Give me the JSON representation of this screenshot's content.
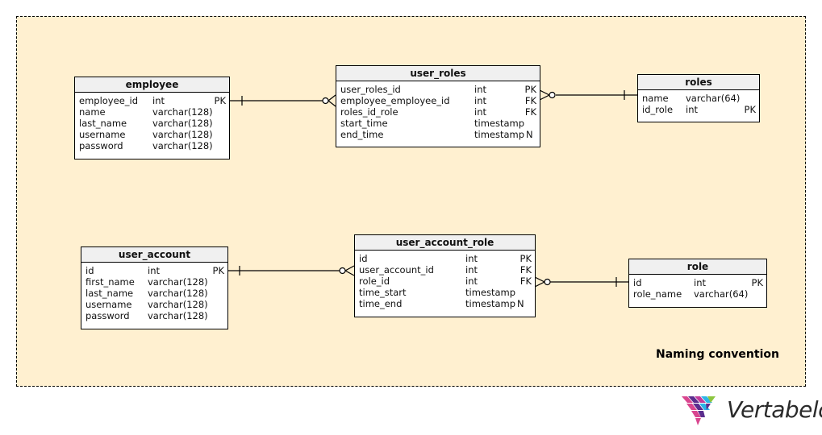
{
  "diagram": {
    "title": "Naming convention",
    "background_color": "#fff0d0",
    "tables": {
      "employee": {
        "name": "employee",
        "columns": [
          {
            "name": "employee_id",
            "type": "int",
            "key": "PK"
          },
          {
            "name": "name",
            "type": "varchar(128)",
            "key": ""
          },
          {
            "name": "last_name",
            "type": "varchar(128)",
            "key": ""
          },
          {
            "name": "username",
            "type": "varchar(128)",
            "key": ""
          },
          {
            "name": "password",
            "type": "varchar(128)",
            "key": ""
          }
        ]
      },
      "user_roles": {
        "name": "user_roles",
        "columns": [
          {
            "name": "user_roles_id",
            "type": "int",
            "key": "PK"
          },
          {
            "name": "employee_employee_id",
            "type": "int",
            "key": "FK"
          },
          {
            "name": "roles_id_role",
            "type": "int",
            "key": "FK"
          },
          {
            "name": "start_time",
            "type": "timestamp",
            "key": ""
          },
          {
            "name": "end_time",
            "type": "timestamp",
            "key": "N"
          }
        ]
      },
      "roles": {
        "name": "roles",
        "columns": [
          {
            "name": "name",
            "type": "varchar(64)",
            "key": ""
          },
          {
            "name": "id_role",
            "type": "int",
            "key": "PK"
          }
        ]
      },
      "user_account": {
        "name": "user_account",
        "columns": [
          {
            "name": "id",
            "type": "int",
            "key": "PK"
          },
          {
            "name": "first_name",
            "type": "varchar(128)",
            "key": ""
          },
          {
            "name": "last_name",
            "type": "varchar(128)",
            "key": ""
          },
          {
            "name": "username",
            "type": "varchar(128)",
            "key": ""
          },
          {
            "name": "password",
            "type": "varchar(128)",
            "key": ""
          }
        ]
      },
      "user_account_role": {
        "name": "user_account_role",
        "columns": [
          {
            "name": "id",
            "type": "int",
            "key": "PK"
          },
          {
            "name": "user_account_id",
            "type": "int",
            "key": "FK"
          },
          {
            "name": "role_id",
            "type": "int",
            "key": "FK"
          },
          {
            "name": "time_start",
            "type": "timestamp",
            "key": ""
          },
          {
            "name": "time_end",
            "type": "timestamp",
            "key": "N"
          }
        ]
      },
      "role": {
        "name": "role",
        "columns": [
          {
            "name": "id",
            "type": "int",
            "key": "PK"
          },
          {
            "name": "role_name",
            "type": "varchar(64)",
            "key": ""
          }
        ]
      }
    },
    "relationships": [
      {
        "from": "employee",
        "to": "user_roles",
        "from_cardinality": "one",
        "to_cardinality": "zero-or-many"
      },
      {
        "from": "roles",
        "to": "user_roles",
        "from_cardinality": "one",
        "to_cardinality": "zero-or-many"
      },
      {
        "from": "user_account",
        "to": "user_account_role",
        "from_cardinality": "one",
        "to_cardinality": "zero-or-many"
      },
      {
        "from": "role",
        "to": "user_account_role",
        "from_cardinality": "one",
        "to_cardinality": "zero-or-many"
      }
    ]
  },
  "brand": {
    "name": "Vertabelo",
    "logo_icon": "vertabelo-logo-icon",
    "colors": [
      "#d9468f",
      "#5b2d8e",
      "#2bb4e6",
      "#8cc63f"
    ]
  }
}
